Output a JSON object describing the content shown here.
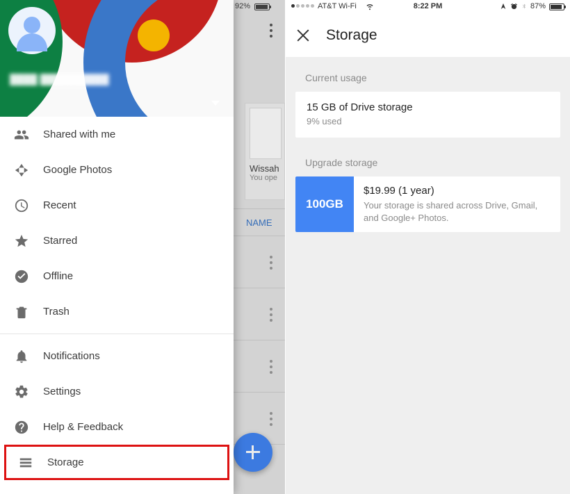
{
  "left": {
    "statusbar": {
      "battery_pct": "92%"
    },
    "background": {
      "card_title": "Wissah",
      "card_sub": "You ope",
      "sort_label": "NAME"
    },
    "drawer": {
      "account_name": "████ ██████████",
      "items": [
        {
          "icon": "people",
          "label": "Shared with me"
        },
        {
          "icon": "photos",
          "label": "Google Photos"
        },
        {
          "icon": "recent",
          "label": "Recent"
        },
        {
          "icon": "star",
          "label": "Starred"
        },
        {
          "icon": "offline",
          "label": "Offline"
        },
        {
          "icon": "trash",
          "label": "Trash"
        }
      ],
      "items2": [
        {
          "icon": "bell",
          "label": "Notifications"
        },
        {
          "icon": "gear",
          "label": "Settings"
        },
        {
          "icon": "help",
          "label": "Help & Feedback"
        },
        {
          "icon": "storage",
          "label": "Storage",
          "highlight": true
        }
      ]
    }
  },
  "right": {
    "statusbar": {
      "carrier": "AT&T Wi-Fi",
      "time": "8:22 PM",
      "battery_pct": "87%"
    },
    "title": "Storage",
    "section1_label": "Current usage",
    "usage_line1": "15 GB of Drive storage",
    "usage_line2": "9% used",
    "section2_label": "Upgrade storage",
    "upgrade": {
      "badge": "100GB",
      "line1": "$19.99 (1 year)",
      "line2": "Your storage is shared across Drive, Gmail, and Google+ Photos."
    }
  }
}
